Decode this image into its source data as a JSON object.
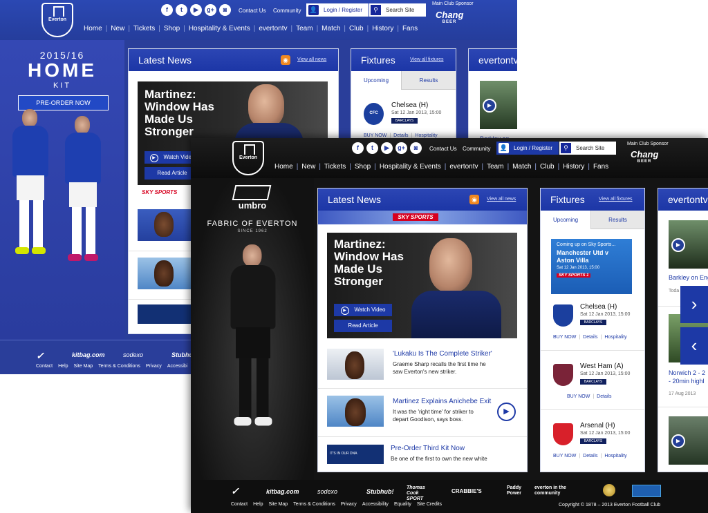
{
  "header": {
    "social_icons": [
      "facebook-icon",
      "twitter-icon",
      "youtube-icon",
      "googleplus-icon",
      "instagram-icon"
    ],
    "social_glyphs": [
      "f",
      "t",
      "▶",
      "g+",
      "◙"
    ],
    "contact_us": "Contact Us",
    "community": "Community",
    "login_register": "Login / Register",
    "search_placeholder": "Search Site",
    "sponsor_label": "Main Club Sponsor",
    "sponsor_name": "Chang",
    "sponsor_sub": "BEER",
    "crest_text": "Everton"
  },
  "nav": [
    "Home",
    "New",
    "Tickets",
    "Shop",
    "Hospitality & Events",
    "evertontv",
    "Team",
    "Match",
    "Club",
    "History",
    "Fans"
  ],
  "back_page": {
    "promo": {
      "season": "2015/16",
      "title": "HOME",
      "subtitle": "KIT",
      "cta": "PRE-ORDER NOW"
    },
    "news_title": "Latest News",
    "view_all_news": "View all news",
    "hero_title": "Martinez:\nWindow Has\nMade Us\nStronger",
    "watch_video": "Watch Video",
    "read_article": "Read Article",
    "fixtures_title": "Fixtures",
    "view_all_fixtures": "View all fixtures",
    "tab_upcoming": "Upcoming",
    "tab_results": "Results",
    "fixture": {
      "name": "Chelsea (H)",
      "date": "Sat 12 Jan 2013, 15:00",
      "buy": "BUY NOW",
      "details": "Details",
      "hospitality": "Hospitality"
    },
    "evertontv_title": "evertontv",
    "video_caption": "Barkley on",
    "sky_sports": "SKY SPORTS",
    "footer_logos": [
      "kitbag.com",
      "sodexo",
      "Stubhub!"
    ],
    "footer_links": [
      "Contact",
      "Help",
      "Site Map",
      "Terms & Conditions",
      "Privacy",
      "Accessibi"
    ]
  },
  "front_page": {
    "promo": {
      "brand": "umbro",
      "fabric": "FABRIC OF EVERTON",
      "since": "SINCE 1962"
    },
    "news_title": "Latest News",
    "view_all_news": "View all news",
    "sky_banner": "SKY SPORTS",
    "hero_title": "Martinez:\nWindow Has\nMade Us\nStronger",
    "watch_video": "Watch Video",
    "read_article": "Read Article",
    "news_items": [
      {
        "title": "'Lukaku Is The Complete Striker'",
        "desc": "Graeme Sharp recalls the first time he saw Everton's new striker."
      },
      {
        "title": "Martinez Explains Anichebe Exit",
        "desc": "It was the 'right time' for striker to depart Goodison, says boss."
      },
      {
        "title": "Pre-Order Third Kit Now",
        "desc": "Be one of the first to own the new white"
      }
    ],
    "dna_thumb": "IT'S IN OUR DNA",
    "fixtures_title": "Fixtures",
    "view_all_fixtures": "View all fixtures",
    "tab_upcoming": "Upcoming",
    "tab_results": "Results",
    "sky_promo": {
      "intro": "Coming up on Sky Sports...",
      "match": "Manchester Utd v\nAston Villa",
      "date": "Sat 12 Jan 2013, 15:00",
      "brand": "SKY SPORTS 1"
    },
    "fixtures": [
      {
        "name": "Chelsea (H)",
        "date": "Sat 12 Jan 2013, 15:00",
        "buy": "BUY NOW",
        "details": "Details",
        "hospitality": "Hospitality",
        "color": "#1b3f9e"
      },
      {
        "name": "West Ham (A)",
        "date": "Sat 12 Jan 2013, 15:00",
        "buy": "BUY NOW",
        "details": "Details",
        "hospitality": "",
        "color": "#7a2338"
      },
      {
        "name": "Arsenal (H)",
        "date": "Sat 12 Jan 2013, 15:00",
        "buy": "BUY NOW",
        "details": "Details",
        "hospitality": "Hospitality",
        "color": "#d8202a"
      }
    ],
    "barclays": "BARCLAYS",
    "evertontv_title": "evertontv",
    "videos": [
      {
        "title": "Barkley on Eng",
        "date": "Toda"
      },
      {
        "title": "Norwich 2 - 2",
        "title2": "- 20min highl",
        "date": "17 Aug 2013"
      }
    ],
    "footer_logos": [
      "kitbag.com",
      "sodexo",
      "Stubhub!",
      "Thomas Cook SPORT",
      "CRABBIE'S",
      "Paddy Power",
      "everton in the community"
    ],
    "footer_links": [
      "Contact",
      "Help",
      "Site Map",
      "Terms & Conditions",
      "Privacy",
      "Accessibility",
      "Equality",
      "Site Credits"
    ],
    "copyright": "Copyright © 1878 – 2013 Everton Football Club"
  },
  "colors": {
    "everton_blue": "#1d39a6",
    "header_dark": "#111111",
    "rss_orange": "#f08820"
  }
}
